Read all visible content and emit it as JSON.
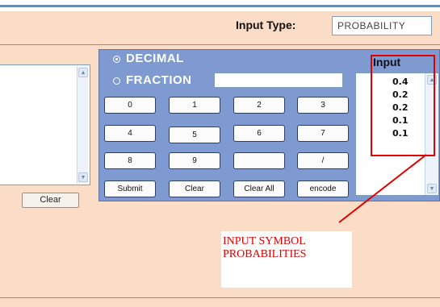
{
  "header": {
    "input_type_label": "Input Type:",
    "input_type_value": "PROBABILITY"
  },
  "left_panel": {
    "clear_label": "Clear"
  },
  "calculator": {
    "mode_decimal": "DECIMAL",
    "mode_fraction": "FRACTION",
    "selected_mode": "DECIMAL",
    "keys": [
      "0",
      "1",
      "2",
      "3",
      "4",
      "5",
      "6",
      "7",
      "8",
      "9",
      "",
      "/",
      "Submit",
      "Clear",
      "Clear All",
      "encode"
    ]
  },
  "input_panel": {
    "label": "Input",
    "values": [
      "0.4",
      "0.2",
      "0.2",
      "0.1",
      "0.1"
    ]
  },
  "annotation": {
    "line1": "INPUT SYMBOL",
    "line2": "PROBABILITIES"
  },
  "colors": {
    "panel_background": "#fbdcc6",
    "calculator_blue": "#7f99d1",
    "annotation_red": "#e00000"
  }
}
